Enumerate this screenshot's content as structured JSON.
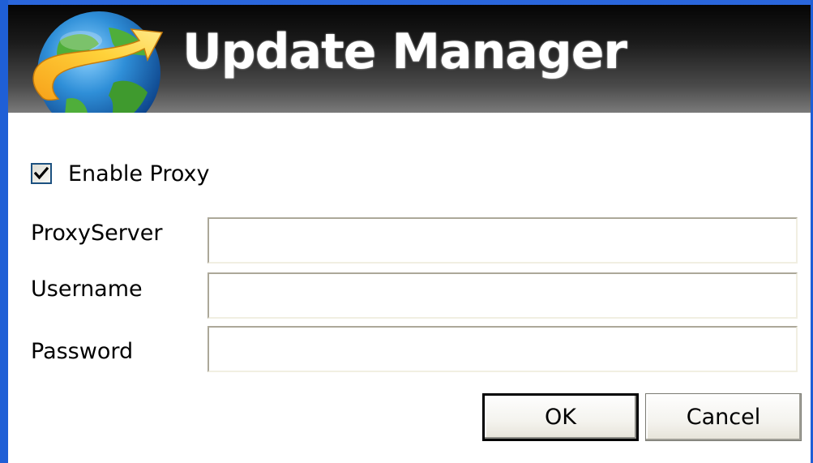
{
  "header": {
    "title": "Update Manager",
    "logo_icon": "globe-update-arrow-icon"
  },
  "proxy": {
    "enable_label": "Enable Proxy",
    "enabled": true
  },
  "fields": {
    "proxy_server": {
      "label": "ProxyServer",
      "value": ""
    },
    "username": {
      "label": "Username",
      "value": ""
    },
    "password": {
      "label": "Password",
      "value": ""
    }
  },
  "buttons": {
    "ok_label": "OK",
    "cancel_label": "Cancel"
  },
  "colors": {
    "frame_blue": "#1f5fd6",
    "header_dark": "#050505",
    "header_light": "#7a7a7a",
    "button_face": "#f4f3ee"
  }
}
